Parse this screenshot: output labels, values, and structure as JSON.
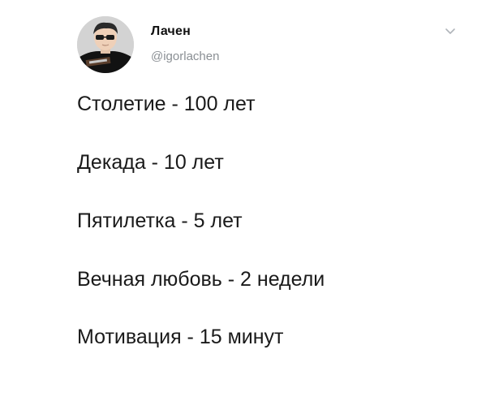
{
  "author": {
    "display_name": "Лачен",
    "handle": "@igorlachen",
    "avatar_icon": "user-avatar-photo",
    "menu_icon": "chevron-down-icon"
  },
  "tweet": {
    "lines": [
      "Столетие - 100 лет",
      "Декада - 10 лет",
      "Пятилетка - 5 лет",
      "Вечная любовь - 2 недели",
      "Мотивация - 15 минут"
    ]
  },
  "colors": {
    "background": "#ffffff",
    "text": "#1a1a1a",
    "handle": "#8a8f94",
    "chevron": "#b0b5ba"
  }
}
